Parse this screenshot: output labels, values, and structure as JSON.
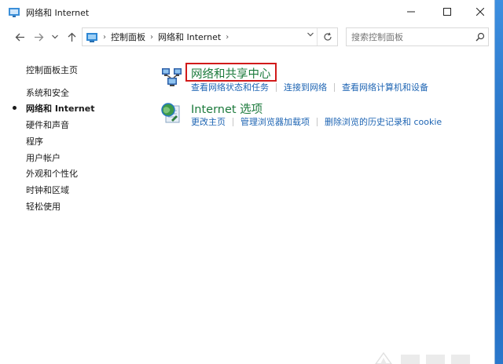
{
  "window": {
    "title": "网络和 Internet",
    "controls": [
      "minimize",
      "maximize",
      "close"
    ]
  },
  "address_bar": {
    "crumbs": [
      "控制面板",
      "网络和 Internet"
    ],
    "search_placeholder": "搜索控制面板"
  },
  "sidebar": {
    "items": [
      {
        "label": "控制面板主页",
        "active": false
      },
      {
        "label": "系统和安全",
        "active": false
      },
      {
        "label": "网络和 Internet",
        "active": true
      },
      {
        "label": "硬件和声音",
        "active": false
      },
      {
        "label": "程序",
        "active": false
      },
      {
        "label": "用户帐户",
        "active": false
      },
      {
        "label": "外观和个性化",
        "active": false
      },
      {
        "label": "时钟和区域",
        "active": false
      },
      {
        "label": "轻松使用",
        "active": false
      }
    ]
  },
  "categories": [
    {
      "title": "网络和共享中心",
      "icon": "network-sharing-center-icon",
      "highlighted": true,
      "links": [
        "查看网络状态和任务",
        "连接到网络",
        "查看网络计算机和设备"
      ]
    },
    {
      "title": "Internet 选项",
      "icon": "internet-options-icon",
      "highlighted": false,
      "links": [
        "更改主页",
        "管理浏览器加载项",
        "删除浏览的历史记录和 cookie"
      ]
    }
  ],
  "colors": {
    "category_title": "#1c7a3c",
    "link": "#1d64b3",
    "highlight_box": "#d11a1a",
    "desktop": "#2a7fd0"
  }
}
